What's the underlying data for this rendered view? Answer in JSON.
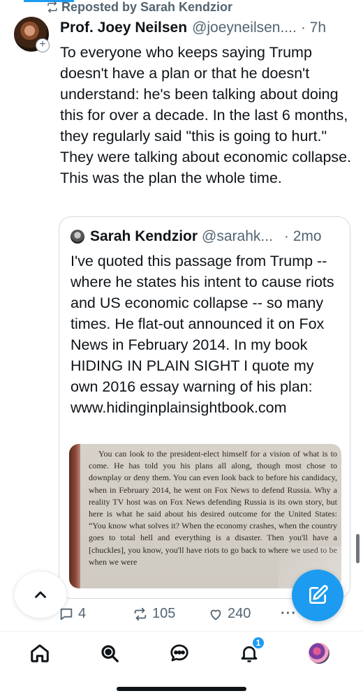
{
  "repost": {
    "label": "Reposted by Sarah Kendzior"
  },
  "post": {
    "author_name": "Prof. Joey Neilsen",
    "author_handle": "@joeyneilsen....",
    "time": "· 7h",
    "text": "To everyone who keeps saying Trump doesn't have a plan or that he doesn't understand: he's been talking about doing this for over a decade. In the last 6 months, they regularly said \"this is going to hurt.\" They were talking about economic collapse. This was the plan the whole time."
  },
  "quote": {
    "author_name": "Sarah Kendzior",
    "author_handle": "@sarahk...",
    "time": "· 2mo",
    "text": "I've quoted this passage from Trump -- where he states his intent to cause riots and US economic collapse -- so many times. He flat-out announced it on Fox News in February 2014. In my book HIDING IN PLAIN SIGHT I quote my own 2016 essay warning of his plan: www.hidinginplainsightbook.com",
    "image_text": "You can look to the president-elect himself for a vision of what is to come. He has told you his plans all along, though most chose to downplay or deny them. You can even look back to before his candidacy, when in February 2014, he went on Fox News to defend Russia. Why a reality TV host was on Fox News defending Russia is its own story, but here is what he said about his desired outcome for the United States: “You know what solves it? When the economy crashes, when the country goes to total hell and everything is a disaster. Then you'll have a [chuckles], you know, you'll have riots to go back to where we used to be when we were"
  },
  "actions": {
    "replies": "4",
    "reposts": "105",
    "likes": "240",
    "more": "···"
  },
  "nav": {
    "notifications_badge": "1"
  },
  "colors": {
    "accent": "#1d9bf0",
    "text": "#0f1419",
    "secondary": "#536471"
  },
  "icons": [
    "repost-icon",
    "plus-icon",
    "chevron-up-icon",
    "compose-icon",
    "reply-icon",
    "like-icon",
    "more-icon",
    "home-icon",
    "search-icon",
    "chat-icon",
    "bell-icon"
  ]
}
